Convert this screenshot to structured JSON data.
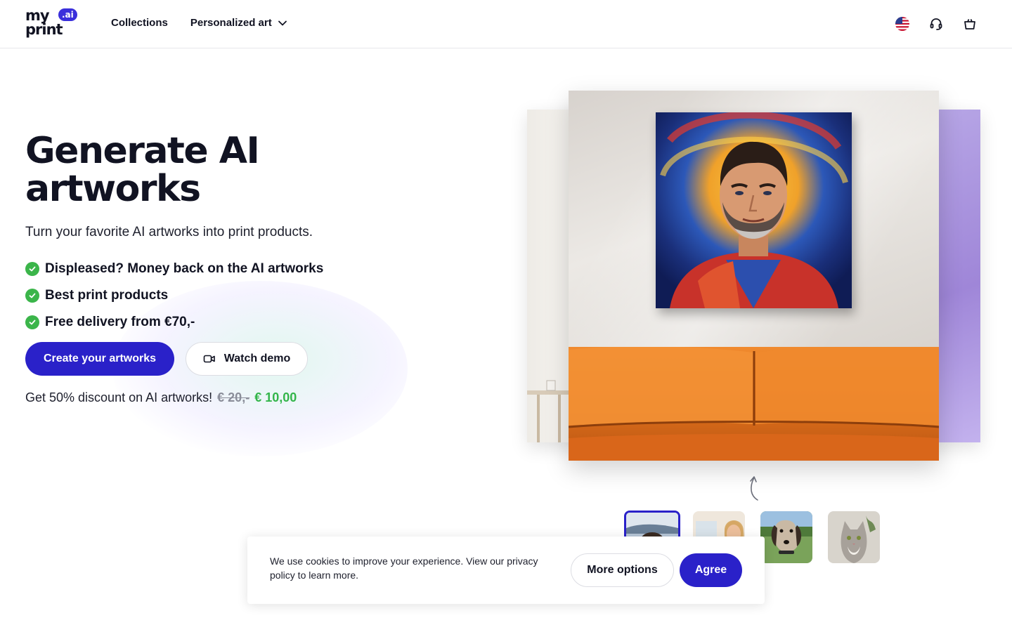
{
  "brand": {
    "line1": "my",
    "line2": "print",
    "badge": ".ai",
    "accent": "#2a21c9",
    "success": "#3bb54a"
  },
  "nav": {
    "collections": "Collections",
    "personalized_art": "Personalized art"
  },
  "header_icons": [
    "us-flag-icon",
    "headset-icon",
    "shopping-bag-icon"
  ],
  "hero": {
    "title": "Generate AI artworks",
    "subtitle": "Turn your favorite AI artworks into print products.",
    "features": [
      "Displeased? Money back on the AI artworks",
      "Best print products",
      "Free delivery from €70,-"
    ],
    "primary_cta": "Create your artworks",
    "secondary_cta": "Watch demo",
    "discount_text": "Get 50% discount on AI artworks!",
    "old_price": "€ 20,-",
    "new_price": "€ 10,00"
  },
  "preview": {
    "thumbnails": [
      "man-portrait-thumbnail",
      "woman-portrait-thumbnail",
      "dog-thumbnail",
      "cat-thumbnail"
    ],
    "selected_thumbnail": 0
  },
  "cookie": {
    "text": "We use cookies to improve your experience. View our privacy policy to learn more.",
    "more_options": "More options",
    "agree": "Agree"
  }
}
